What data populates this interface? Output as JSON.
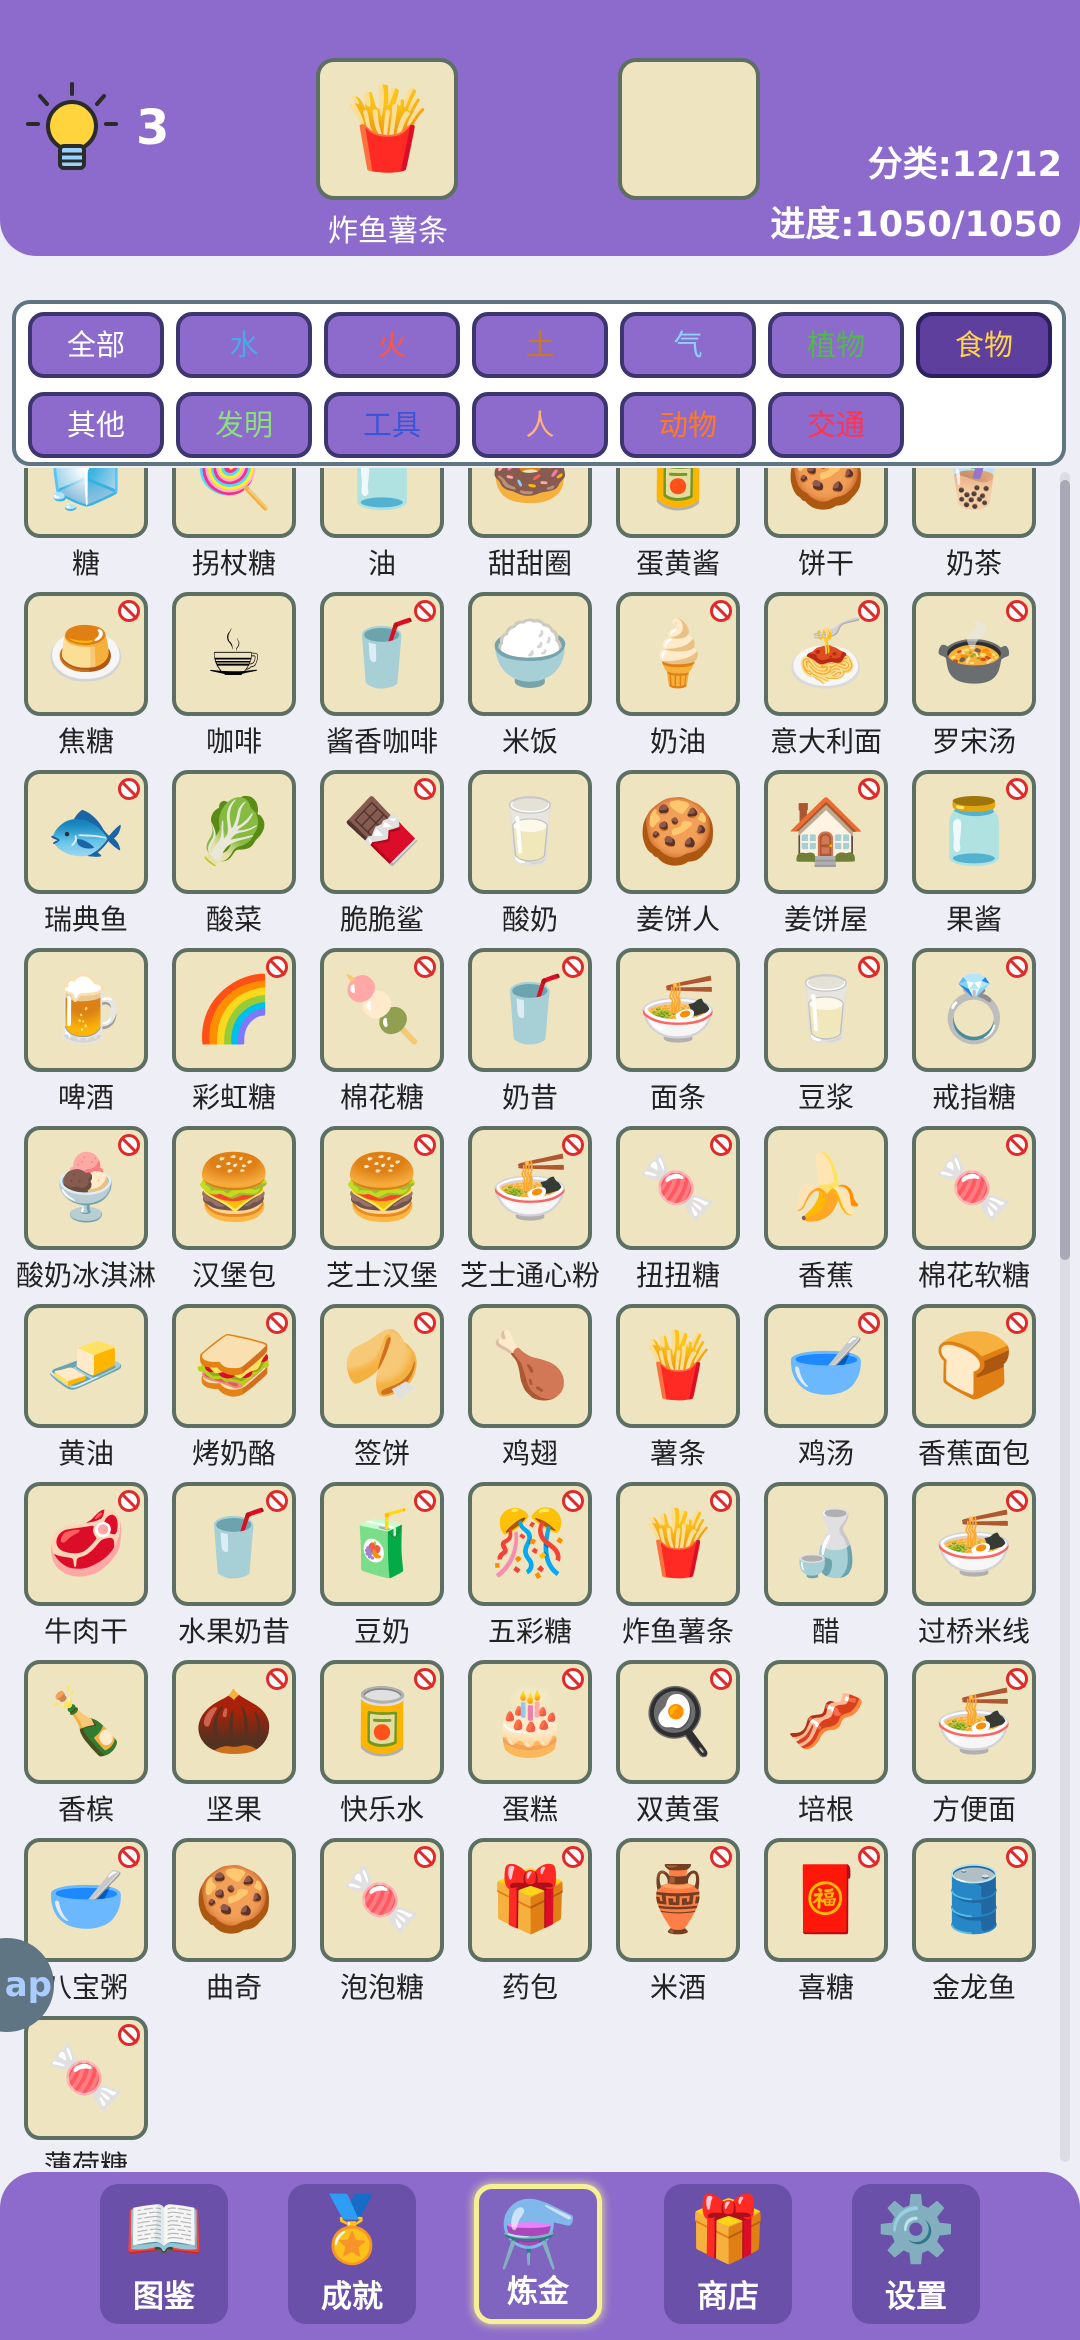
{
  "header": {
    "hint_count": "3",
    "slot_a_icon": "🍟",
    "slot_a_label": "炸鱼薯条",
    "category_progress": "分类:12/12",
    "total_progress": "进度:1050/1050"
  },
  "filters": [
    {
      "label": "全部",
      "color": "#ffffff",
      "selected": false
    },
    {
      "label": "水",
      "color": "#4ea7e8",
      "selected": false
    },
    {
      "label": "火",
      "color": "#ff5544",
      "selected": false
    },
    {
      "label": "土",
      "color": "#c7772e",
      "selected": false
    },
    {
      "label": "气",
      "color": "#8fd0ff",
      "selected": false
    },
    {
      "label": "植物",
      "color": "#53b84c",
      "selected": false
    },
    {
      "label": "食物",
      "color": "#ffd34d",
      "selected": true
    },
    {
      "label": "其他",
      "color": "#ffffff",
      "selected": false
    },
    {
      "label": "发明",
      "color": "#8be07c",
      "selected": false
    },
    {
      "label": "工具",
      "color": "#3a55d6",
      "selected": false
    },
    {
      "label": "人",
      "color": "#ffb37a",
      "selected": false
    },
    {
      "label": "动物",
      "color": "#ff7a1e",
      "selected": false
    },
    {
      "label": "交通",
      "color": "#ff3352",
      "selected": false
    }
  ],
  "items": [
    {
      "name": "糖",
      "icon": "🧊",
      "ban": false
    },
    {
      "name": "拐杖糖",
      "icon": "🍭",
      "ban": false
    },
    {
      "name": "油",
      "icon": "🫙",
      "ban": false
    },
    {
      "name": "甜甜圈",
      "icon": "🍩",
      "ban": false
    },
    {
      "name": "蛋黄酱",
      "icon": "🥫",
      "ban": false
    },
    {
      "name": "饼干",
      "icon": "🍪",
      "ban": false
    },
    {
      "name": "奶茶",
      "icon": "🧋",
      "ban": false
    },
    {
      "name": "焦糖",
      "icon": "🍮",
      "ban": true
    },
    {
      "name": "咖啡",
      "icon": "☕",
      "ban": false
    },
    {
      "name": "酱香咖啡",
      "icon": "🥤",
      "ban": true
    },
    {
      "name": "米饭",
      "icon": "🍚",
      "ban": false
    },
    {
      "name": "奶油",
      "icon": "🍦",
      "ban": true
    },
    {
      "name": "意大利面",
      "icon": "🍝",
      "ban": true
    },
    {
      "name": "罗宋汤",
      "icon": "🍲",
      "ban": true
    },
    {
      "name": "瑞典鱼",
      "icon": "🐟",
      "ban": true
    },
    {
      "name": "酸菜",
      "icon": "🥬",
      "ban": false
    },
    {
      "name": "脆脆鲨",
      "icon": "🍫",
      "ban": true
    },
    {
      "name": "酸奶",
      "icon": "🥛",
      "ban": false
    },
    {
      "name": "姜饼人",
      "icon": "🍪",
      "ban": false
    },
    {
      "name": "姜饼屋",
      "icon": "🏠",
      "ban": true
    },
    {
      "name": "果酱",
      "icon": "🫙",
      "ban": true
    },
    {
      "name": "啤酒",
      "icon": "🍺",
      "ban": false
    },
    {
      "name": "彩虹糖",
      "icon": "🌈",
      "ban": true
    },
    {
      "name": "棉花糖",
      "icon": "🍡",
      "ban": true
    },
    {
      "name": "奶昔",
      "icon": "🥤",
      "ban": true
    },
    {
      "name": "面条",
      "icon": "🍜",
      "ban": false
    },
    {
      "name": "豆浆",
      "icon": "🥛",
      "ban": true
    },
    {
      "name": "戒指糖",
      "icon": "💍",
      "ban": true
    },
    {
      "name": "酸奶冰淇淋",
      "icon": "🍨",
      "ban": true
    },
    {
      "name": "汉堡包",
      "icon": "🍔",
      "ban": false
    },
    {
      "name": "芝士汉堡",
      "icon": "🍔",
      "ban": true
    },
    {
      "name": "芝士通心粉",
      "icon": "🍜",
      "ban": true
    },
    {
      "name": "扭扭糖",
      "icon": "🍬",
      "ban": true
    },
    {
      "name": "香蕉",
      "icon": "🍌",
      "ban": false
    },
    {
      "name": "棉花软糖",
      "icon": "🍬",
      "ban": true
    },
    {
      "name": "黄油",
      "icon": "🧈",
      "ban": false
    },
    {
      "name": "烤奶酪",
      "icon": "🥪",
      "ban": true
    },
    {
      "name": "签饼",
      "icon": "🥠",
      "ban": true
    },
    {
      "name": "鸡翅",
      "icon": "🍗",
      "ban": false
    },
    {
      "name": "薯条",
      "icon": "🍟",
      "ban": false
    },
    {
      "name": "鸡汤",
      "icon": "🥣",
      "ban": true
    },
    {
      "name": "香蕉面包",
      "icon": "🍞",
      "ban": true
    },
    {
      "name": "牛肉干",
      "icon": "🥩",
      "ban": true
    },
    {
      "name": "水果奶昔",
      "icon": "🥤",
      "ban": true
    },
    {
      "name": "豆奶",
      "icon": "🧃",
      "ban": true
    },
    {
      "name": "五彩糖",
      "icon": "🎊",
      "ban": true
    },
    {
      "name": "炸鱼薯条",
      "icon": "🍟",
      "ban": true
    },
    {
      "name": "醋",
      "icon": "🍶",
      "ban": false
    },
    {
      "name": "过桥米线",
      "icon": "🍜",
      "ban": true
    },
    {
      "name": "香槟",
      "icon": "🍾",
      "ban": false
    },
    {
      "name": "坚果",
      "icon": "🌰",
      "ban": true
    },
    {
      "name": "快乐水",
      "icon": "🥫",
      "ban": true
    },
    {
      "name": "蛋糕",
      "icon": "🎂",
      "ban": true
    },
    {
      "name": "双黄蛋",
      "icon": "🍳",
      "ban": true
    },
    {
      "name": "培根",
      "icon": "🥓",
      "ban": false
    },
    {
      "name": "方便面",
      "icon": "🍜",
      "ban": true
    },
    {
      "name": "八宝粥",
      "icon": "🥣",
      "ban": true
    },
    {
      "name": "曲奇",
      "icon": "🍪",
      "ban": false
    },
    {
      "name": "泡泡糖",
      "icon": "🍬",
      "ban": true
    },
    {
      "name": "药包",
      "icon": "🎁",
      "ban": true
    },
    {
      "name": "米酒",
      "icon": "🏺",
      "ban": true
    },
    {
      "name": "喜糖",
      "icon": "🧧",
      "ban": true
    },
    {
      "name": "金龙鱼",
      "icon": "🛢️",
      "ban": true
    },
    {
      "name": "薄荷糖",
      "icon": "🍬",
      "ban": true
    }
  ],
  "side_tab_label": "ap",
  "nav": [
    {
      "label": "图鉴",
      "icon": "📖",
      "active": false
    },
    {
      "label": "成就",
      "icon": "🏅",
      "active": false
    },
    {
      "label": "炼金",
      "icon": "⚗️",
      "active": true
    },
    {
      "label": "商店",
      "icon": "🎁",
      "active": false
    },
    {
      "label": "设置",
      "icon": "⚙️",
      "active": false
    }
  ],
  "icon_names": {
    "hint": "lightbulb-icon"
  }
}
